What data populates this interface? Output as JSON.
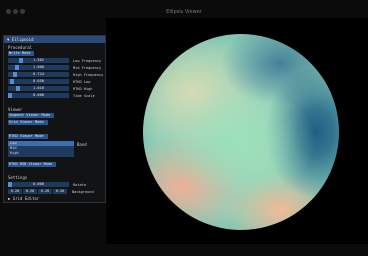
{
  "window": {
    "title": "Ellipsis Viewer"
  },
  "panel": {
    "header": "▼ Ellipsoid",
    "sections": {
      "procedural": "Procedural",
      "viewer": "Viewer",
      "settings": "Settings"
    },
    "buttons": {
      "write_mode": "Write Mode",
      "segment_viewer": "Segment Viewer Mode",
      "grid_viewer": "Grid Viewer Mode",
      "rtkd_viewer": "RTKD Viewer Mode",
      "rtkd_rgb_viewer": "RTKD RGB Viewer Mode"
    },
    "sliders": [
      {
        "value": "1.562",
        "label": "Low Frequency",
        "level": 0.18
      },
      {
        "value": "1.000",
        "label": "Mid Frequency",
        "level": 0.12
      },
      {
        "value": "0.724",
        "label": "High Frequency",
        "level": 0.09
      },
      {
        "value": "0.050",
        "label": "RTKD Low",
        "level": 0.03
      },
      {
        "value": "1.010",
        "label": "RTKD High",
        "level": 0.14
      },
      {
        "value": "0.000",
        "label": "Time Scale",
        "level": 0.0
      }
    ],
    "band": {
      "label": "Band",
      "items": [
        "Low",
        "Mid",
        "High"
      ],
      "selected": "Low"
    },
    "rotate": {
      "value": "0.000",
      "label": "Rotate",
      "level": 0.0
    },
    "background": {
      "label": "Background",
      "values": [
        "0.20",
        "0.20",
        "0.20",
        "0.20"
      ]
    },
    "grid_editor": "▶ Grid Editor"
  }
}
